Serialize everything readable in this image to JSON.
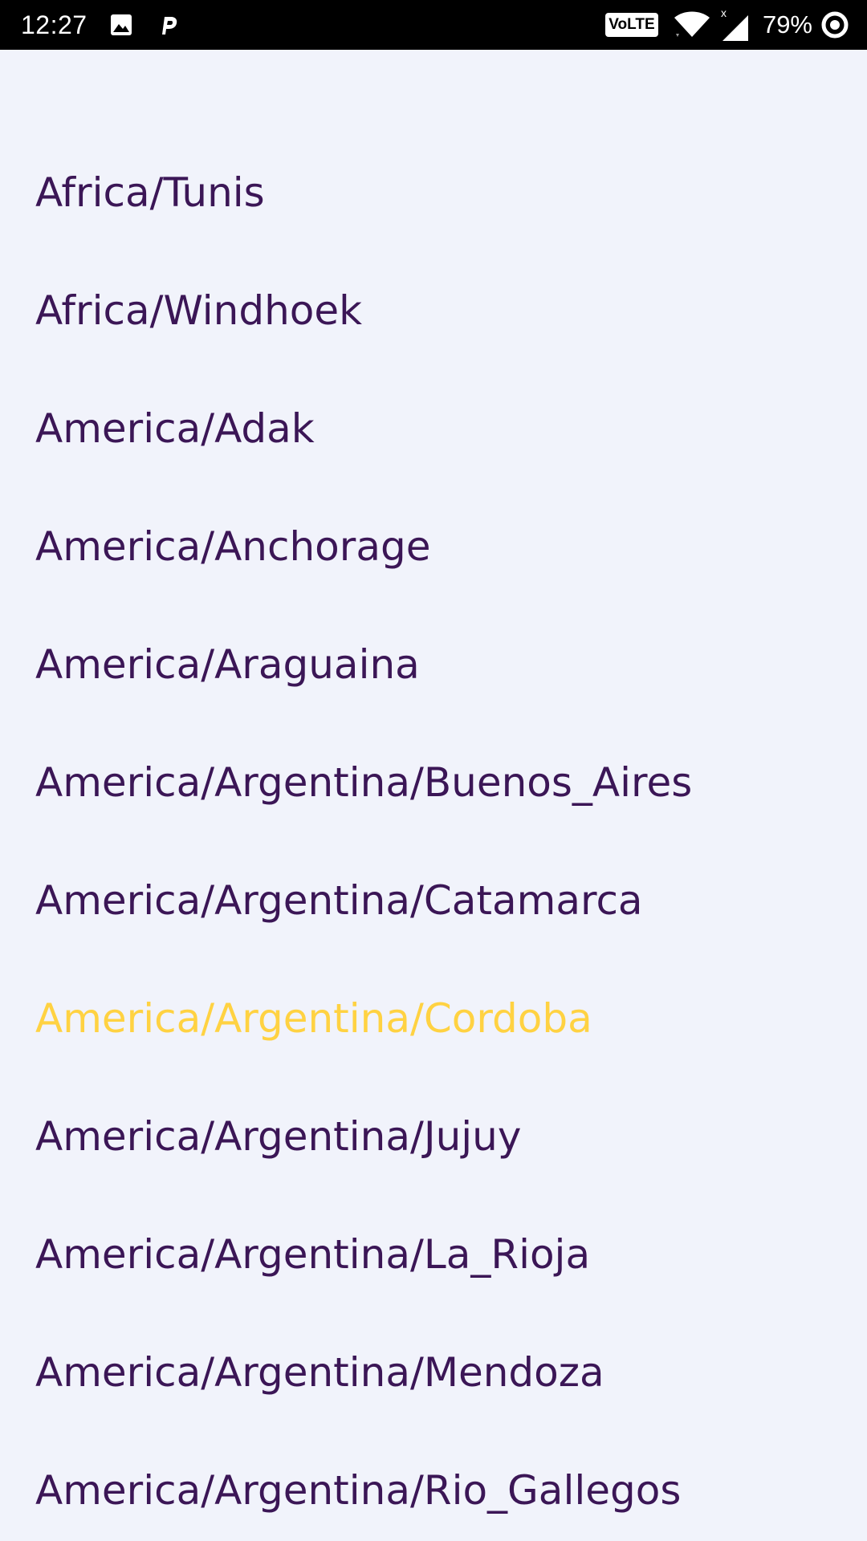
{
  "status_bar": {
    "time": "12:27",
    "network_badge": "VoLTE",
    "battery": "79%",
    "icons": [
      "image-icon",
      "p-app-icon",
      "wifi-icon",
      "signal-icon",
      "battery-ring-icon"
    ]
  },
  "timezone_list": {
    "selected_index": 7,
    "colors": {
      "item": "#3b1656",
      "selected": "#ffd242",
      "background": "#f1f3fb"
    },
    "items": [
      {
        "label": "Africa/Tunis"
      },
      {
        "label": "Africa/Windhoek"
      },
      {
        "label": "America/Adak"
      },
      {
        "label": "America/Anchorage"
      },
      {
        "label": "America/Araguaina"
      },
      {
        "label": "America/Argentina/Buenos_Aires"
      },
      {
        "label": "America/Argentina/Catamarca"
      },
      {
        "label": "America/Argentina/Cordoba"
      },
      {
        "label": "America/Argentina/Jujuy"
      },
      {
        "label": "America/Argentina/La_Rioja"
      },
      {
        "label": "America/Argentina/Mendoza"
      },
      {
        "label": "America/Argentina/Rio_Gallegos"
      }
    ]
  }
}
